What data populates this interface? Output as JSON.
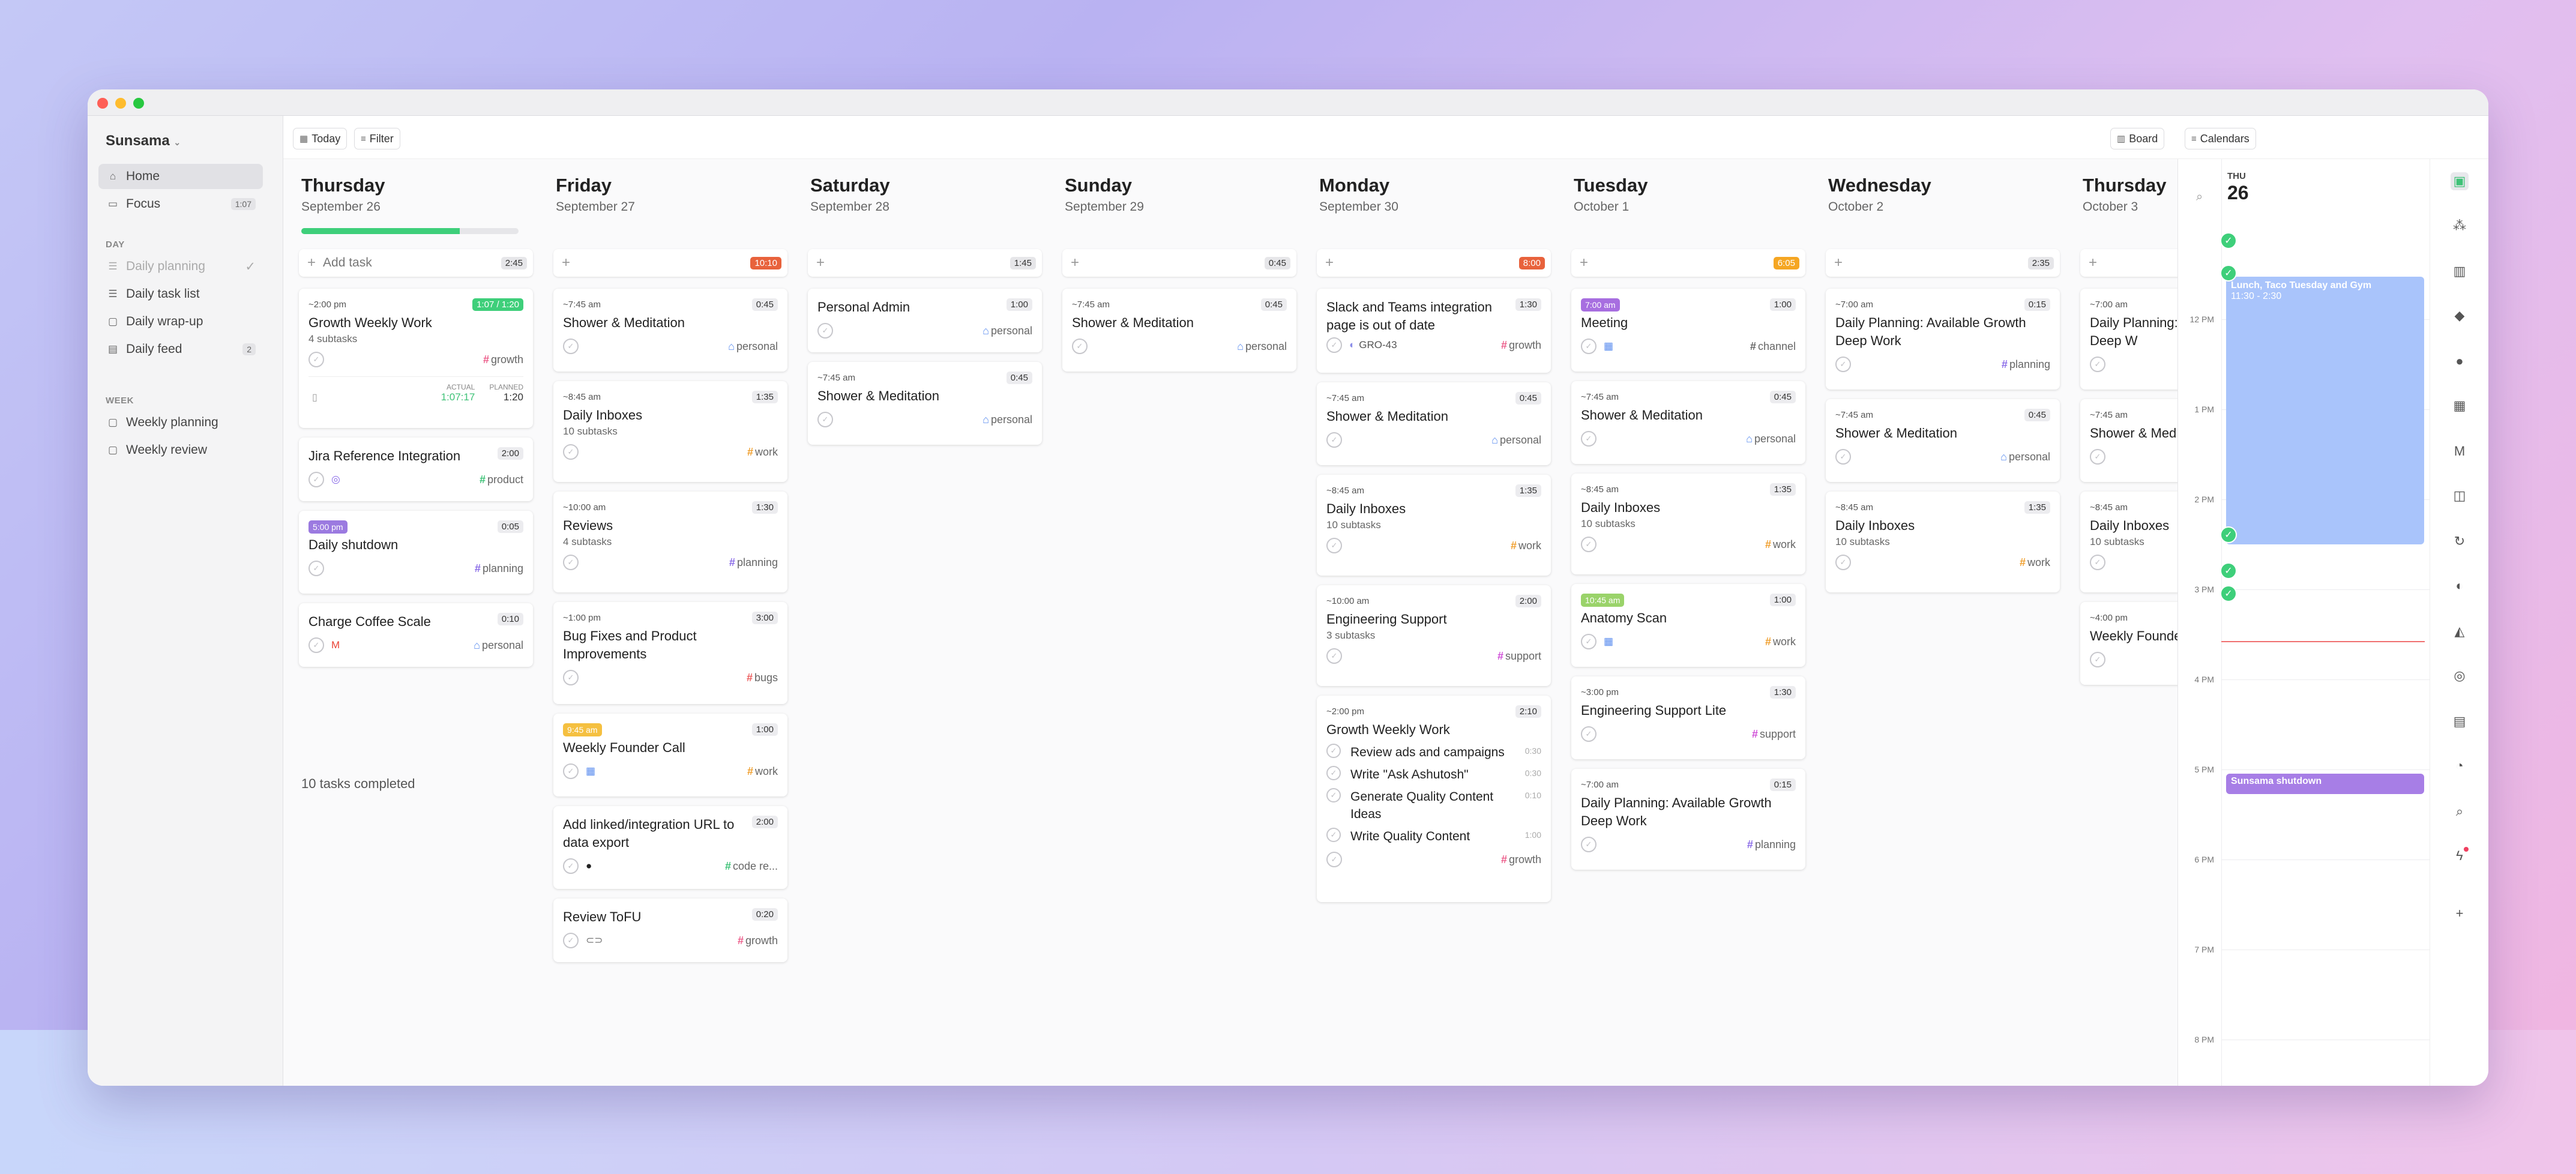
{
  "sidebar": {
    "workspace": "Sunsama",
    "home": "Home",
    "focus": "Focus",
    "focus_count": "1:07",
    "day_section": "DAY",
    "daily_planning": "Daily planning",
    "daily_task_list": "Daily task list",
    "daily_wrapup": "Daily wrap-up",
    "daily_feed": "Daily feed",
    "daily_feed_count": "2",
    "week_section": "WEEK",
    "weekly_planning": "Weekly planning",
    "weekly_review": "Weekly review"
  },
  "toolbar": {
    "today": "Today",
    "filter": "Filter",
    "board": "Board",
    "calendars": "Calendars"
  },
  "add_task_label": "Add task",
  "days": [
    {
      "name": "Thursday",
      "date": "September 26",
      "total": "2:45",
      "progress": 0.73,
      "completed_text": "10 tasks completed",
      "tasks": [
        {
          "time": "~2:00 pm",
          "badge": "1:07 / 1:20",
          "title": "Growth Weekly Work",
          "sub": "4 subtasks",
          "channel": "growth",
          "actual_label": "ACTUAL",
          "actual": "1:07:17",
          "planned_label": "PLANNED",
          "planned": "1:20"
        },
        {
          "badge": "2:00",
          "title": "Jira Reference Integration",
          "channel": "product"
        },
        {
          "pill": "5:00 pm",
          "badge": "0:05",
          "title": "Daily shutdown",
          "channel": "planning"
        },
        {
          "badge": "0:10",
          "title": "Charge Coffee Scale",
          "channel": "personal"
        }
      ]
    },
    {
      "name": "Friday",
      "date": "September 27",
      "total": "10:10",
      "tasks": [
        {
          "time": "~7:45 am",
          "badge": "0:45",
          "title": "Shower & Meditation",
          "channel": "personal"
        },
        {
          "time": "~8:45 am",
          "badge": "1:35",
          "title": "Daily Inboxes",
          "sub": "10 subtasks",
          "channel": "work"
        },
        {
          "time": "~10:00 am",
          "badge": "1:30",
          "title": "Reviews",
          "sub": "4 subtasks",
          "channel": "planning"
        },
        {
          "time": "~1:00 pm",
          "badge": "3:00",
          "title": "Bug Fixes and Product Improvements",
          "channel": "bugs"
        },
        {
          "pill": "9:45 am",
          "badge": "1:00",
          "title": "Weekly Founder Call",
          "channel": "work"
        },
        {
          "badge": "2:00",
          "title": "Add linked/integration URL to data export",
          "channel": "code re..."
        },
        {
          "badge": "0:20",
          "title": "Review ToFU",
          "channel": "growth"
        }
      ]
    },
    {
      "name": "Saturday",
      "date": "September 28",
      "total": "1:45",
      "tasks": [
        {
          "badge": "1:00",
          "title": "Personal Admin",
          "channel": "personal"
        },
        {
          "time": "~7:45 am",
          "badge": "0:45",
          "title": "Shower & Meditation",
          "channel": "personal"
        }
      ]
    },
    {
      "name": "Sunday",
      "date": "September 29",
      "total": "0:45",
      "tasks": [
        {
          "time": "~7:45 am",
          "badge": "0:45",
          "title": "Shower & Meditation",
          "channel": "personal"
        }
      ]
    },
    {
      "name": "Monday",
      "date": "September 30",
      "total": "8:00",
      "tasks": [
        {
          "badge": "1:30",
          "title": "Slack and Teams integration page is out of date",
          "ref": "GRO-43",
          "channel": "growth"
        },
        {
          "time": "~7:45 am",
          "badge": "0:45",
          "title": "Shower & Meditation",
          "channel": "personal"
        },
        {
          "time": "~8:45 am",
          "badge": "1:35",
          "title": "Daily Inboxes",
          "sub": "10 subtasks",
          "channel": "work"
        },
        {
          "time": "~10:00 am",
          "badge": "2:00",
          "title": "Engineering Support",
          "sub": "3 subtasks",
          "channel": "support"
        },
        {
          "time": "~2:00 pm",
          "badge": "2:10",
          "title": "Growth Weekly Work",
          "channel": "growth",
          "subtasks": [
            {
              "title": "Review ads and campaigns",
              "dur": "0:30"
            },
            {
              "title": "Write \"Ask Ashutosh\"",
              "dur": "0:30"
            },
            {
              "title": "Generate Quality Content Ideas",
              "dur": "0:10"
            },
            {
              "title": "Write Quality Content",
              "dur": "1:00"
            }
          ]
        }
      ]
    },
    {
      "name": "Tuesday",
      "date": "October 1",
      "total": "6:05",
      "tasks": [
        {
          "pill": "7:00 am",
          "badge": "1:00",
          "title": "Meeting",
          "channel": "channel"
        },
        {
          "time": "~7:45 am",
          "badge": "0:45",
          "title": "Shower & Meditation",
          "channel": "personal"
        },
        {
          "time": "~8:45 am",
          "badge": "1:35",
          "title": "Daily Inboxes",
          "sub": "10 subtasks",
          "channel": "work"
        },
        {
          "pill": "10:45 am",
          "badge": "1:00",
          "title": "Anatomy Scan",
          "channel": "work"
        },
        {
          "time": "~3:00 pm",
          "badge": "1:30",
          "title": "Engineering Support Lite",
          "channel": "support"
        },
        {
          "time": "~7:00 am",
          "badge": "0:15",
          "title": "Daily Planning: Available Growth Deep Work",
          "channel": "planning"
        }
      ]
    },
    {
      "name": "Wednesday",
      "date": "October 2",
      "total": "2:35",
      "tasks": [
        {
          "time": "~7:00 am",
          "badge": "0:15",
          "title": "Daily Planning: Available Growth Deep Work",
          "channel": "planning"
        },
        {
          "time": "~7:45 am",
          "badge": "0:45",
          "title": "Shower & Meditation",
          "channel": "personal"
        },
        {
          "time": "~8:45 am",
          "badge": "1:35",
          "title": "Daily Inboxes",
          "sub": "10 subtasks",
          "channel": "work"
        }
      ]
    },
    {
      "name": "Thursday",
      "date": "October 3",
      "tasks": [
        {
          "time": "~7:00 am",
          "title": "Daily Planning: Available Growth Deep W"
        },
        {
          "time": "~7:45 am",
          "title": "Shower & Med"
        },
        {
          "time": "~8:45 am",
          "title": "Daily Inboxes",
          "sub": "10 subtasks"
        },
        {
          "time": "~4:00 pm",
          "title": "Weekly Founde"
        }
      ]
    }
  ],
  "calendar": {
    "day_abbr": "THU",
    "day_num": "26",
    "hours": [
      "12 PM",
      "1 PM",
      "2 PM",
      "3 PM",
      "4 PM",
      "5 PM",
      "6 PM",
      "7 PM",
      "8 PM"
    ],
    "events": [
      {
        "title": "Lunch, Taco Tuesday and Gym",
        "time": "11:30 - 2:30"
      },
      {
        "title": "Sunsama shutdown"
      }
    ]
  },
  "colors": {
    "growth": "#ec5f8c",
    "product": "#3ec277",
    "planning": "#8b6de8",
    "personal": "#5b8def",
    "work": "#f0a030",
    "bugs": "#ec5f5f",
    "support": "#d04fd8",
    "channel": "#666666",
    "code": "#3ec277"
  }
}
